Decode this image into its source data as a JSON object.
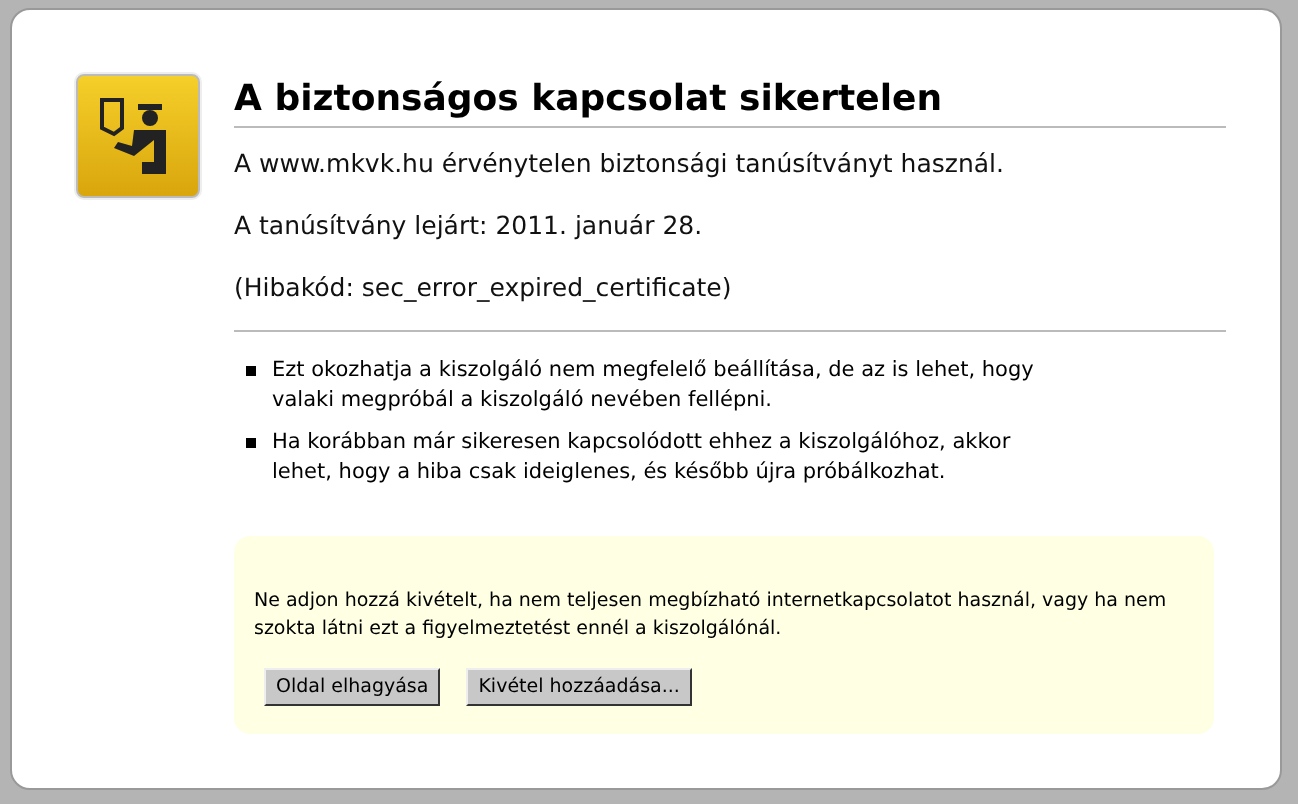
{
  "title": "A biztonságos kapcsolat sikertelen",
  "messages": [
    "A www.mkvk.hu érvénytelen biztonsági tanúsítványt használ.",
    "A tanúsítvány lejárt:  2011. január 28.",
    "(Hibakód: sec_error_expired_certificate)"
  ],
  "reasons": [
    "Ezt okozhatja a kiszolgáló nem megfelelő beállítása, de az is lehet, hogy valaki megpróbál a kiszolgáló nevében fellépni.",
    "Ha korábban már sikeresen kapcsolódott ehhez a kiszolgálóhoz, akkor lehet, hogy a hiba csak ideiglenes, és később újra próbálkozhat."
  ],
  "warning": {
    "text": "Ne adjon hozzá kivételt, ha nem teljesen megbízható internetkapcsolatot használ, vagy ha nem szokta látni ezt a figyelmeztetést ennél a kiszolgálónál.",
    "buttons": [
      "Oldal elhagyása",
      "Kivétel hozzáadása..."
    ]
  }
}
